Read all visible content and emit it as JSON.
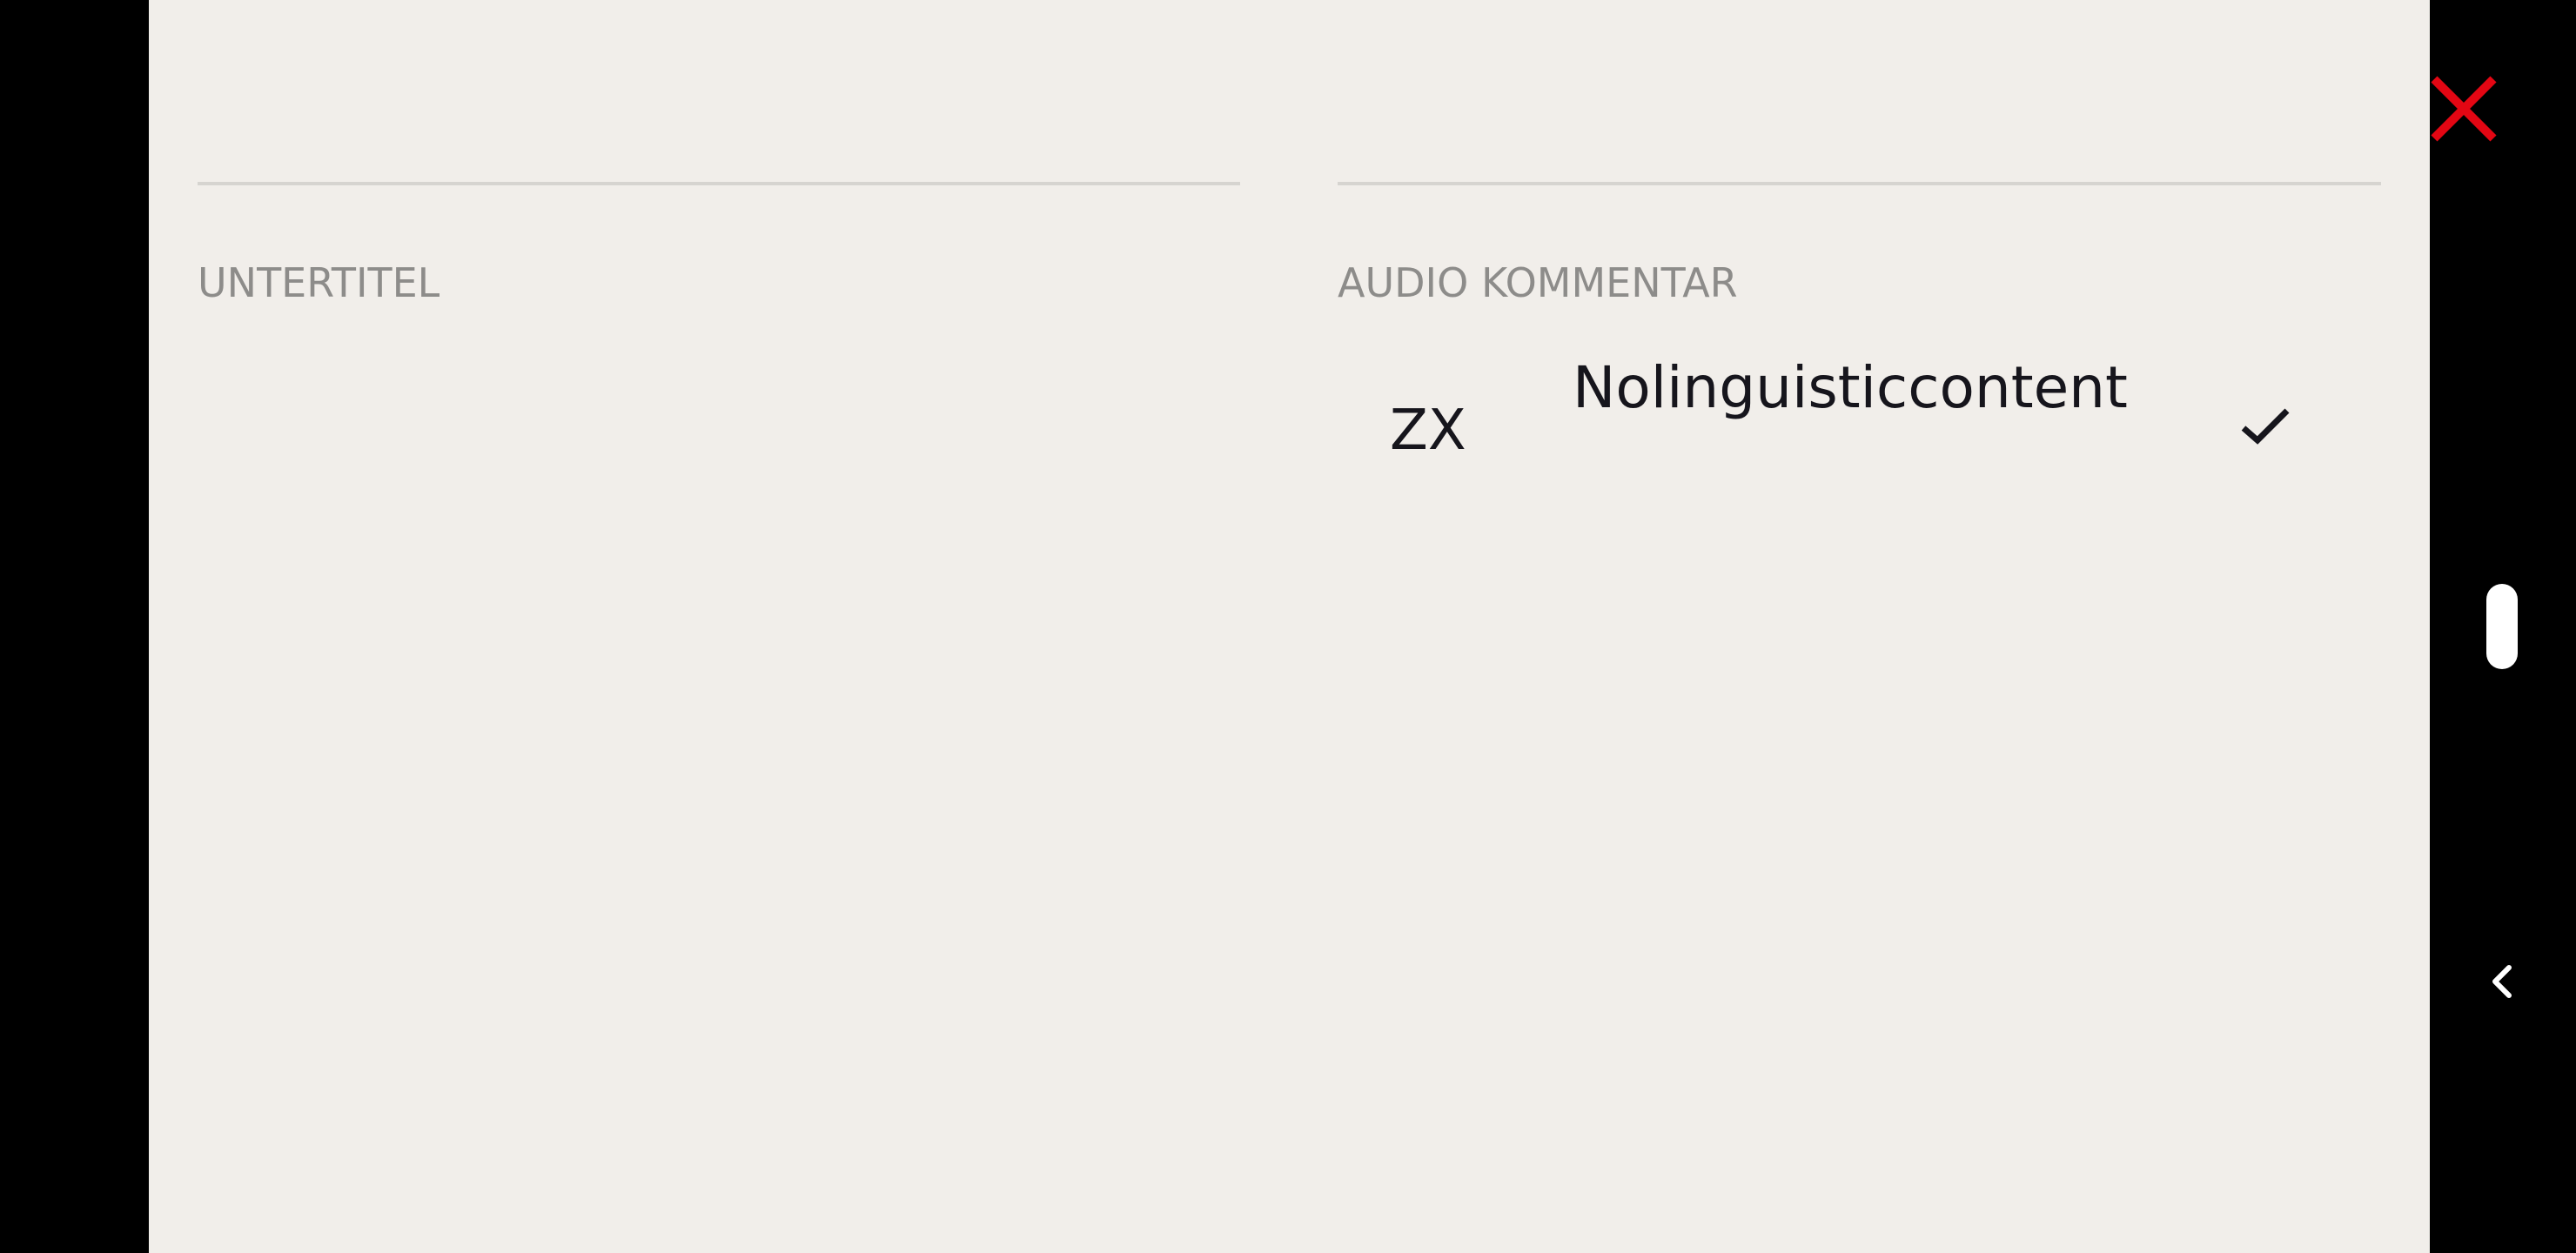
{
  "colors": {
    "panel_background": "#f1eeea",
    "outer_background": "#000000",
    "close_accent": "#e30613",
    "heading_text": "#8d8c8a",
    "body_text": "#16151c",
    "divider": "#d6d4d0"
  },
  "close_icon": "close-x-icon",
  "subtitles": {
    "heading": "UNTERTITEL"
  },
  "audio": {
    "heading": "AUDIO KOMMENTAR",
    "options": [
      {
        "code": "ZX",
        "name": "Nolinguisticcontent",
        "selected": true,
        "selected_icon": "checkmark-icon"
      }
    ]
  },
  "system_nav": {
    "scroll_icon": "scroll-handle",
    "back_icon": "chevron-left-icon"
  }
}
